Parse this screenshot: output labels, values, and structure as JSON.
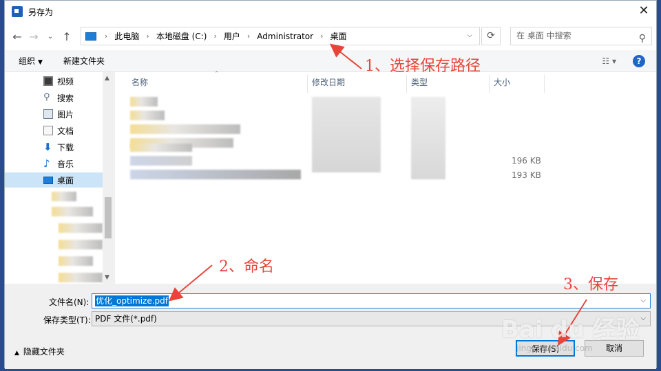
{
  "window": {
    "title": "另存为"
  },
  "address": {
    "crumbs": [
      "此电脑",
      "本地磁盘 (C:)",
      "用户",
      "Administrator",
      "桌面"
    ],
    "search_placeholder": "在 桌面 中搜索"
  },
  "toolbar": {
    "organize": "组织",
    "new_folder": "新建文件夹"
  },
  "nav": {
    "items": [
      "视频",
      "搜索",
      "图片",
      "文档",
      "下载",
      "音乐",
      "桌面"
    ]
  },
  "columns": {
    "name": "名称",
    "date": "修改日期",
    "type": "类型",
    "size": "大小"
  },
  "files": {
    "sizes": [
      "196 KB",
      "193 KB"
    ]
  },
  "bottom": {
    "filename_label": "文件名(N):",
    "filename_value": "优化_optimize.pdf",
    "filetype_label": "保存类型(T):",
    "filetype_value": "PDF 文件(*.pdf)",
    "hide_folders": "隐藏文件夹",
    "save": "保存(S)",
    "cancel": "取消"
  },
  "annotations": {
    "step1": "1、选择保存路径",
    "step2": "2、命名",
    "step3": "3、保存",
    "color": "#e8443a"
  },
  "watermark": {
    "text": "Bai du 经验",
    "sub": "jingyan.baidu.com"
  }
}
